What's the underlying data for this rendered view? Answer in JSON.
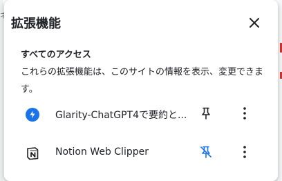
{
  "popup": {
    "title": "拡張機能",
    "close_icon": "close-icon"
  },
  "access": {
    "heading": "すべてのアクセス",
    "description": "これらの拡張機能は、このサイトの情報を表示、変更できます。"
  },
  "extensions": [
    {
      "name": "Glarity-ChatGPT4で要約と...",
      "icon": "glarity-logo-icon",
      "icon_color": "#1a73e8",
      "pinned": true,
      "pin_color": "#202124"
    },
    {
      "name": "Notion Web Clipper",
      "icon": "notion-logo-icon",
      "pinned": false,
      "pin_color": "#1a73e8"
    }
  ]
}
